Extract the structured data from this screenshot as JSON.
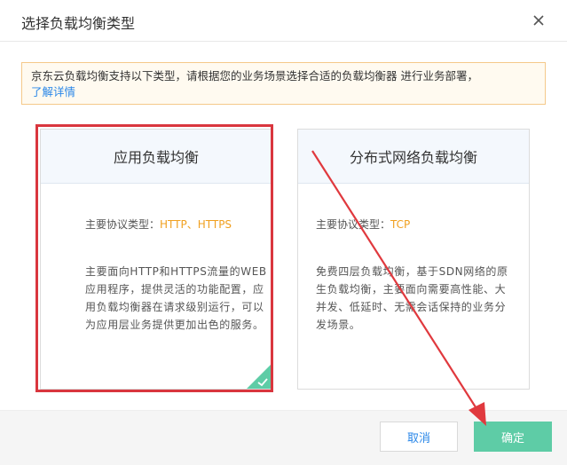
{
  "dialog": {
    "title": "选择负载均衡类型"
  },
  "notice": {
    "text": "京东云负载均衡支持以下类型，请根据您的业务场景选择合适的负载均衡器 进行业务部署，",
    "link": "了解详情"
  },
  "cards": [
    {
      "title": "应用负载均衡",
      "protocol_label": "主要协议类型：",
      "protocol_value": "HTTP、HTTPS",
      "description": "主要面向HTTP和HTTPS流量的WEB应用程序，提供灵活的功能配置，应用负载均衡器在请求级别运行，可以为应用层业务提供更加出色的服务。",
      "selected": true
    },
    {
      "title": "分布式网络负载均衡",
      "protocol_label": "主要协议类型：",
      "protocol_value": "TCP",
      "description": "免费四层负载均衡，基于SDN网络的原生负载均衡，主要面向需要高性能、大并发、低延时、无需会话保持的业务分发场景。",
      "selected": false
    }
  ],
  "footer": {
    "cancel_label": "取消",
    "ok_label": "确定"
  },
  "colors": {
    "accent": "#5ecca6",
    "link": "#2a87e8",
    "protocol": "#f0a020",
    "annotation": "#d9363e"
  },
  "icons": {
    "close": "close-icon",
    "selected": "check-icon"
  }
}
